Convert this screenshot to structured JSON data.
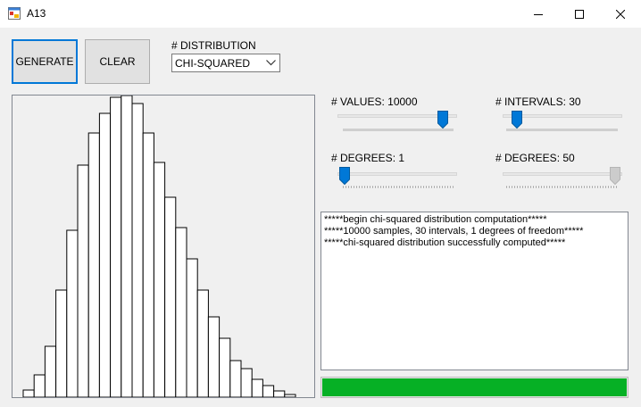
{
  "window": {
    "title": "A13",
    "controls": [
      "minimize-icon",
      "maximize-icon",
      "close-icon"
    ]
  },
  "buttons": {
    "generate": "GENERATE",
    "clear": "CLEAR"
  },
  "distribution": {
    "label": "# DISTRIBUTION",
    "selected": "CHI-SQUARED"
  },
  "sliders": {
    "values": {
      "label": "# VALUES: 10000",
      "fraction": 0.93,
      "enabled": true
    },
    "intervals": {
      "label": "# INTERVALS: 30",
      "fraction": 0.07,
      "enabled": true
    },
    "degrees_left": {
      "label": "# DEGREES: 1",
      "fraction": 0.0,
      "enabled": true
    },
    "degrees_right": {
      "label": "# DEGREES: 50",
      "fraction": 1.0,
      "enabled": false
    }
  },
  "log": {
    "lines": [
      "*****begin chi-squared distribution computation*****",
      "*****10000 samples, 30 intervals, 1 degrees of freedom*****",
      "*****chi-squared distribution successfully computed*****"
    ]
  },
  "progress": {
    "value": 1.0,
    "color": "#06b025"
  },
  "colors": {
    "accent": "#0078d7",
    "disabled_thumb": "#cccccc"
  },
  "chart_data": {
    "type": "bar",
    "title": "",
    "xlabel": "",
    "ylabel": "",
    "values": [
      8,
      25,
      57,
      120,
      187,
      260,
      296,
      318,
      336,
      338,
      329,
      296,
      263,
      224,
      190,
      155,
      120,
      90,
      66,
      41,
      32,
      20,
      13,
      7,
      3
    ]
  }
}
